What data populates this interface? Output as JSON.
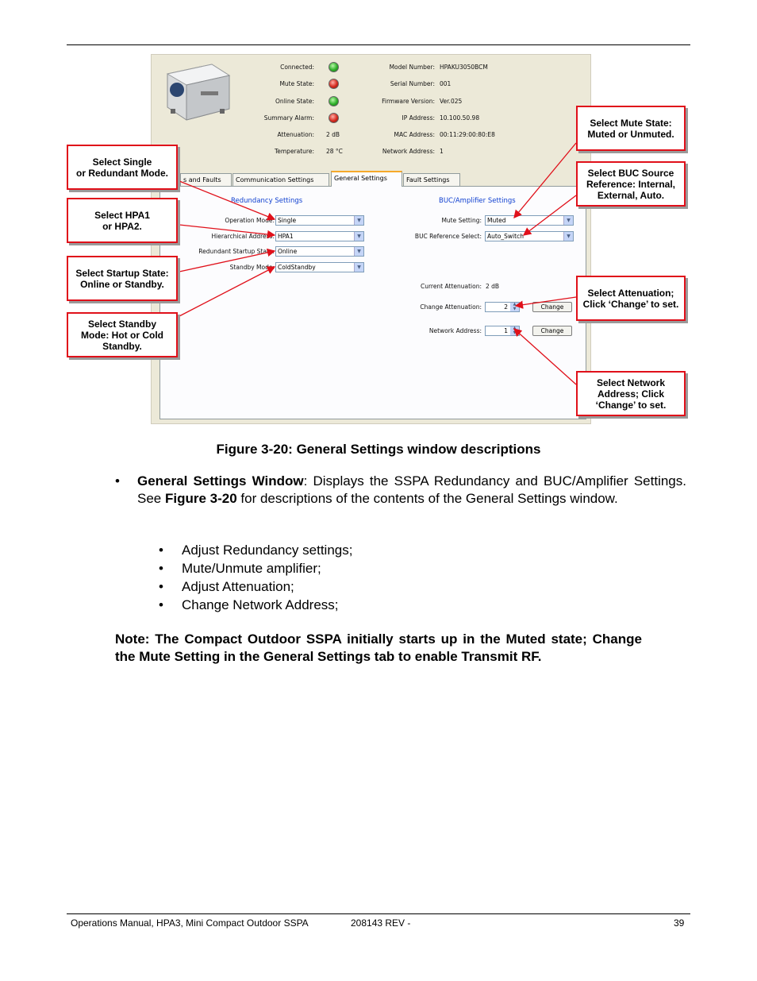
{
  "screenshot": {
    "status": [
      {
        "label": "Connected:",
        "state": "green"
      },
      {
        "label": "Mute State:",
        "state": "red"
      },
      {
        "label": "Online State:",
        "state": "green"
      },
      {
        "label": "Summary Alarm:",
        "state": "red"
      },
      {
        "label": "Attenuation:",
        "value": "2 dB"
      },
      {
        "label": "Temperature:",
        "value": "28 °C"
      }
    ],
    "info": [
      {
        "label": "Model Number:",
        "value": "HPAKU3050BCM"
      },
      {
        "label": "Serial Number:",
        "value": "001"
      },
      {
        "label": "Firmware Version:",
        "value": "Ver.025"
      },
      {
        "label": "IP Address:",
        "value": "10.100.50.98"
      },
      {
        "label": "MAC Address:",
        "value": "00:11:29:00:80:E8"
      },
      {
        "label": "Network Address:",
        "value": "1"
      }
    ],
    "tabs": [
      "s and Faults",
      "Communication Settings",
      "General Settings",
      "Fault Settings"
    ],
    "redundancy": {
      "title": "Redundancy Settings",
      "operation_mode_label": "Operation Mode:",
      "operation_mode": "Single",
      "hier_label": "Hierarchical Address:",
      "hier": "HPA1",
      "startup_label": "Redundant Startup State:",
      "startup": "Online",
      "standby_label": "Standby Mode:",
      "standby": "ColdStandby"
    },
    "buc": {
      "title": "BUC/Amplifier Settings",
      "mute_label": "Mute Setting:",
      "mute": "Muted",
      "ref_label": "BUC Reference Select:",
      "ref": "Auto_Switch",
      "cur_att_label": "Current Attenuation:",
      "cur_att": "2 dB",
      "change_att_label": "Change Attenuation:",
      "change_att": "2",
      "net_label": "Network Address:",
      "net": "1",
      "change_btn": "Change"
    }
  },
  "callouts": {
    "single": "Select Single\nor Redundant Mode.",
    "hpa": "Select HPA1\nor HPA2.",
    "startup": "Select Startup State:\nOnline or Standby.",
    "standby": "Select Standby\nMode: Hot or Cold\nStandby.",
    "mute": "Select Mute State:\nMuted or Unmuted.",
    "buc": "Select BUC Source\nReference: Internal,\nExternal, Auto.",
    "atten": "Select Attenuation;\nClick ‘Change’ to set.",
    "network": "Select Network\nAddress; Click\n‘Change’ to set."
  },
  "caption": "Figure 3-20: General Settings window descriptions",
  "para": {
    "bold1": "General Settings Window",
    "text1": ": Displays the SSPA Redundancy and BUC/Amplifier Settings. See ",
    "bold2": "Figure 3-20",
    "text2": " for descriptions of the contents of the General Settings window."
  },
  "bullets": [
    "Adjust Redundancy settings;",
    "Mute/Unmute amplifier;",
    "Adjust Attenuation;",
    "Change Network Address;"
  ],
  "note": "Note: The Compact Outdoor SSPA initially starts up in the Muted state; Change the Mute Setting in the General Settings tab to enable Transmit RF.",
  "footer": {
    "left": "Operations Manual, HPA3, Mini Compact Outdoor SSPA",
    "mid": "208143 REV -",
    "page": "39"
  }
}
